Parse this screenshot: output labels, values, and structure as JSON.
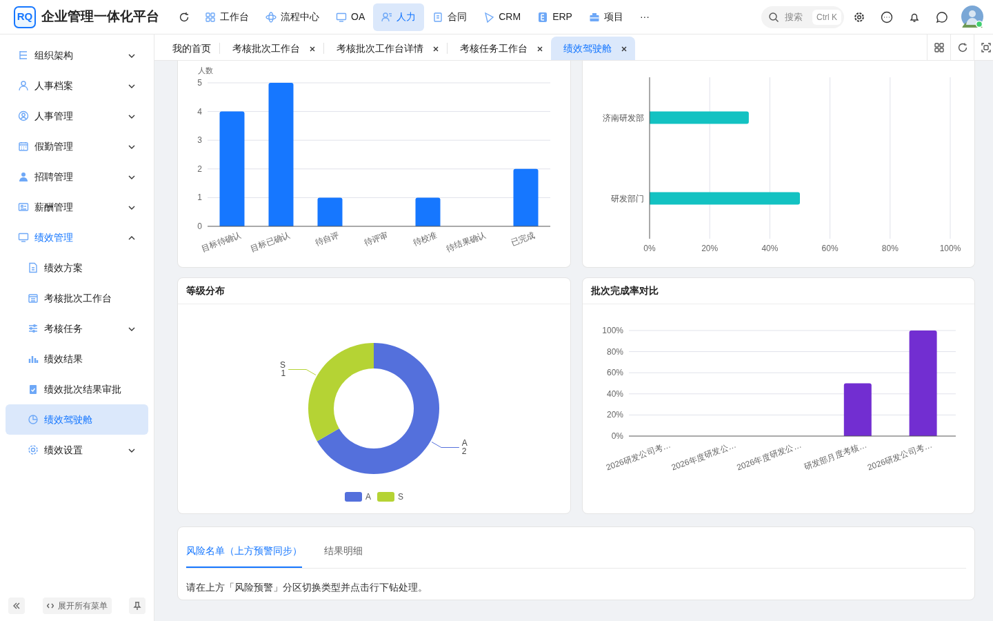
{
  "header": {
    "logo": "RQ",
    "title": "企业管理一体化平台",
    "nav": [
      {
        "label": "工作台",
        "selected": false
      },
      {
        "label": "流程中心",
        "selected": false
      },
      {
        "label": "OA",
        "selected": false
      },
      {
        "label": "人力",
        "selected": true
      },
      {
        "label": "合同",
        "selected": false
      },
      {
        "label": "CRM",
        "selected": false
      },
      {
        "label": "ERP",
        "selected": false
      },
      {
        "label": "项目",
        "selected": false
      }
    ],
    "more": "···",
    "search": {
      "placeholder": "搜索",
      "shortcut": "Ctrl K"
    }
  },
  "sidebar": {
    "items": [
      {
        "label": "组织架构",
        "kind": "group",
        "expanded": false,
        "selected": false
      },
      {
        "label": "人事档案",
        "kind": "group",
        "expanded": false,
        "selected": false
      },
      {
        "label": "人事管理",
        "kind": "group",
        "expanded": false,
        "selected": false
      },
      {
        "label": "假勤管理",
        "kind": "group",
        "expanded": false,
        "selected": false
      },
      {
        "label": "招聘管理",
        "kind": "group",
        "expanded": false,
        "selected": false
      },
      {
        "label": "薪酬管理",
        "kind": "group",
        "expanded": false,
        "selected": false
      },
      {
        "label": "绩效管理",
        "kind": "group",
        "expanded": true,
        "selected": false,
        "children": [
          {
            "label": "绩效方案",
            "kind": "leaf",
            "selected": false
          },
          {
            "label": "考核批次工作台",
            "kind": "leaf",
            "selected": false
          },
          {
            "label": "考核任务",
            "kind": "group",
            "expanded": false,
            "selected": false
          },
          {
            "label": "绩效结果",
            "kind": "leaf",
            "selected": false
          },
          {
            "label": "绩效批次结果审批",
            "kind": "leaf",
            "selected": false
          },
          {
            "label": "绩效驾驶舱",
            "kind": "leaf",
            "selected": true
          },
          {
            "label": "绩效设置",
            "kind": "group",
            "expanded": false,
            "selected": false
          }
        ]
      }
    ],
    "expand_all": "展开所有菜单"
  },
  "tabs": [
    {
      "label": "我的首页",
      "closable": false,
      "selected": false
    },
    {
      "label": "考核批次工作台",
      "closable": true,
      "selected": false
    },
    {
      "label": "考核批次工作台详情",
      "closable": true,
      "selected": false
    },
    {
      "label": "考核任务工作台",
      "closable": true,
      "selected": false
    },
    {
      "label": "绩效驾驶舱",
      "closable": true,
      "selected": true
    }
  ],
  "panels": [
    {
      "chart_data": {
        "type": "bar",
        "grid": true,
        "ylabel": "人数",
        "categories": [
          "目标待确认",
          "目标已确认",
          "待自评",
          "待评审",
          "待校准",
          "待结果确认",
          "已完成"
        ],
        "values": [
          4,
          5,
          1,
          0,
          1,
          0,
          2
        ],
        "ylim": [
          0,
          5
        ],
        "yticks": [
          0,
          1,
          2,
          3,
          4,
          5
        ]
      }
    },
    {
      "chart_data": {
        "type": "bar",
        "grid": true,
        "orientation": "horizontal",
        "categories": [
          "济南研发部",
          "研发部门"
        ],
        "values": [
          0.33,
          0.5
        ],
        "xlim": [
          0,
          1
        ],
        "xticks": [
          {
            "value": 0,
            "label": "0%"
          },
          {
            "value": 0.2,
            "label": "20%"
          },
          {
            "value": 0.4,
            "label": "40%"
          },
          {
            "value": 0.6,
            "label": "60%"
          },
          {
            "value": 0.8,
            "label": "80%"
          },
          {
            "value": 1,
            "label": "100%"
          }
        ]
      }
    },
    {
      "title": "等级分布",
      "chart_data": {
        "type": "donut",
        "legend": "bottom",
        "categories": [
          "A",
          "S"
        ],
        "values": [
          2,
          1
        ],
        "data_labels": true
      }
    },
    {
      "title": "批次完成率对比",
      "chart_data": {
        "type": "bar",
        "grid": true,
        "categories": [
          "2026研发公司考…",
          "2026年度研发公…",
          "2026年度研发公…",
          "研发部月度考核…",
          "2026研发公司考…"
        ],
        "values": [
          0,
          0,
          0,
          0.5,
          1
        ],
        "ylim": [
          0,
          1
        ],
        "yticks": [
          {
            "value": 0,
            "label": "0%"
          },
          {
            "value": 0.2,
            "label": "20%"
          },
          {
            "value": 0.4,
            "label": "40%"
          },
          {
            "value": 0.6,
            "label": "60%"
          },
          {
            "value": 0.8,
            "label": "80%"
          },
          {
            "value": 1,
            "label": "100%"
          }
        ]
      }
    }
  ],
  "bottom": {
    "tabs": [
      {
        "label": "风险名单（上方预警同步）",
        "selected": true
      },
      {
        "label": "结果明细",
        "selected": false
      }
    ],
    "message": "请在上方「风险预警」分区切换类型并点击行下钻处理。"
  }
}
